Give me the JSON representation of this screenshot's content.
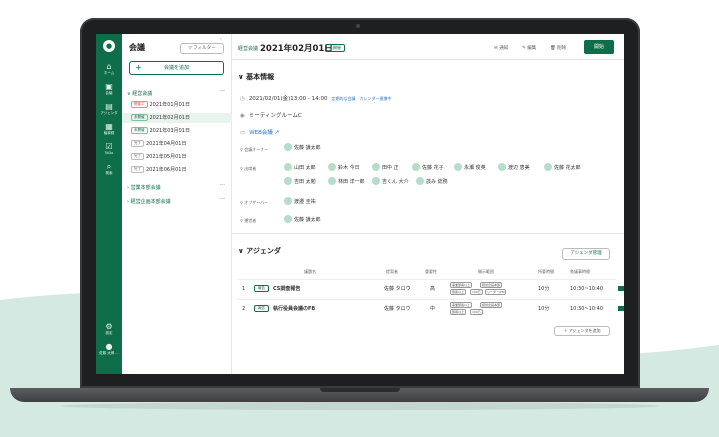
{
  "nav": {
    "items": [
      {
        "icon": "home-icon",
        "glyph": "⌂",
        "label": "ホーム"
      },
      {
        "icon": "meeting-icon",
        "glyph": "▣",
        "label": "会議"
      },
      {
        "icon": "document-icon",
        "glyph": "▤",
        "label": "アジェンダ"
      },
      {
        "icon": "minutes-icon",
        "glyph": "▦",
        "label": "議事録"
      },
      {
        "icon": "task-icon",
        "glyph": "☑",
        "label": "ToDo"
      },
      {
        "icon": "search-icon",
        "glyph": "⌕",
        "label": "検索"
      }
    ],
    "settings": {
      "glyph": "⚙",
      "label": "設定"
    },
    "user": {
      "glyph": "●",
      "label": "佐藤 太郎 ..."
    }
  },
  "list": {
    "title": "会議",
    "filter": "▽ フィルター",
    "close": "‹",
    "add": "会議を追加",
    "group1": "∨ 経営会議",
    "rows": [
      {
        "tag": "開催中",
        "tag_style": "red",
        "date": "2021年01月01日"
      },
      {
        "tag": "未開催",
        "tag_style": "green",
        "date": "2021年02月01日"
      },
      {
        "tag": "未開催",
        "tag_style": "green",
        "date": "2021年03月01日"
      },
      {
        "tag": "完了",
        "tag_style": "",
        "date": "2021年04月01日"
      },
      {
        "tag": "完了",
        "tag_style": "",
        "date": "2021年05月01日"
      },
      {
        "tag": "完了",
        "tag_style": "",
        "date": "2021年06月01日"
      }
    ],
    "group2": "› 営業本部会議",
    "group3": "› 経営企画本部会議",
    "dots": "···"
  },
  "main": {
    "breadcrumb": "経営会議",
    "title": "2021年02月01日",
    "status": "未開催",
    "tools": [
      "✉ 通知",
      "✎ 編集",
      "🗑 削除"
    ],
    "start": "開始",
    "basic_heading": "∨ 基本情報",
    "datetime": "2021/02/01(金)13:00 - 14:00",
    "link1": "定期的な会議",
    "link2": "カレンダー連携中",
    "room": "ミーティングルームC",
    "web": "WEB会議 ↗",
    "owner_label": "会議オーナー",
    "owner": "佐藤 謙太郎",
    "attendee_label": "出席者",
    "attendees": [
      "山田 太郎",
      "鈴木 今日",
      "田中 正",
      "佐藤 花子",
      "永瀬 俊英",
      "渡辺 恵美",
      "佐藤 花太郎",
      "吉田 太勉",
      "林田 洋一郎",
      "吉くん 大介",
      "該み 総務"
    ],
    "observer_label": "オブザーバー",
    "observer": "渡邉 圭祐",
    "manager_label": "運営者",
    "manager": "佐藤 謙太郎",
    "agenda_heading": "∨ アジェンダ",
    "agenda_button": "アジェンダ管理",
    "agenda_columns": [
      "議題名",
      "提案者",
      "重要性",
      "開示範囲",
      "所要時間",
      "各議事時間"
    ],
    "agenda_rows": [
      {
        "no": "1",
        "kind": "報告",
        "name": "CS調査報告",
        "by": "佐藤 タロウ",
        "priority": "高",
        "scope": [
          "事業部長以上",
          "経営企画本部",
          "部長以上",
          "100万",
          "リーダー/PM"
        ],
        "duration": "10分",
        "time": "10:30~10:40"
      },
      {
        "no": "2",
        "kind": "報告",
        "name": "執行役員会議のFB",
        "by": "佐藤 タロウ",
        "priority": "中",
        "scope": [
          "事業部長以上",
          "経営企画本部",
          "部長以上",
          "100万"
        ],
        "duration": "10分",
        "time": "10:30~10:40"
      }
    ],
    "add_agenda": "＋ アジェンダを追加"
  }
}
